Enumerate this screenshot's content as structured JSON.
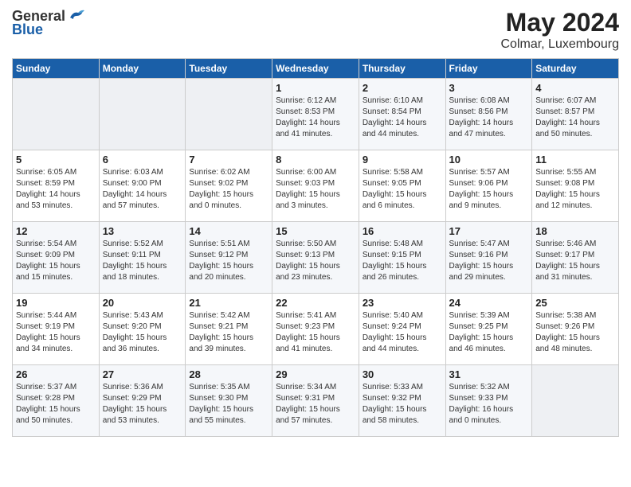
{
  "header": {
    "logo_general": "General",
    "logo_blue": "Blue",
    "month_title": "May 2024",
    "location": "Colmar, Luxembourg"
  },
  "days_of_week": [
    "Sunday",
    "Monday",
    "Tuesday",
    "Wednesday",
    "Thursday",
    "Friday",
    "Saturday"
  ],
  "weeks": [
    [
      {
        "num": "",
        "info": ""
      },
      {
        "num": "",
        "info": ""
      },
      {
        "num": "",
        "info": ""
      },
      {
        "num": "1",
        "info": "Sunrise: 6:12 AM\nSunset: 8:53 PM\nDaylight: 14 hours\nand 41 minutes."
      },
      {
        "num": "2",
        "info": "Sunrise: 6:10 AM\nSunset: 8:54 PM\nDaylight: 14 hours\nand 44 minutes."
      },
      {
        "num": "3",
        "info": "Sunrise: 6:08 AM\nSunset: 8:56 PM\nDaylight: 14 hours\nand 47 minutes."
      },
      {
        "num": "4",
        "info": "Sunrise: 6:07 AM\nSunset: 8:57 PM\nDaylight: 14 hours\nand 50 minutes."
      }
    ],
    [
      {
        "num": "5",
        "info": "Sunrise: 6:05 AM\nSunset: 8:59 PM\nDaylight: 14 hours\nand 53 minutes."
      },
      {
        "num": "6",
        "info": "Sunrise: 6:03 AM\nSunset: 9:00 PM\nDaylight: 14 hours\nand 57 minutes."
      },
      {
        "num": "7",
        "info": "Sunrise: 6:02 AM\nSunset: 9:02 PM\nDaylight: 15 hours\nand 0 minutes."
      },
      {
        "num": "8",
        "info": "Sunrise: 6:00 AM\nSunset: 9:03 PM\nDaylight: 15 hours\nand 3 minutes."
      },
      {
        "num": "9",
        "info": "Sunrise: 5:58 AM\nSunset: 9:05 PM\nDaylight: 15 hours\nand 6 minutes."
      },
      {
        "num": "10",
        "info": "Sunrise: 5:57 AM\nSunset: 9:06 PM\nDaylight: 15 hours\nand 9 minutes."
      },
      {
        "num": "11",
        "info": "Sunrise: 5:55 AM\nSunset: 9:08 PM\nDaylight: 15 hours\nand 12 minutes."
      }
    ],
    [
      {
        "num": "12",
        "info": "Sunrise: 5:54 AM\nSunset: 9:09 PM\nDaylight: 15 hours\nand 15 minutes."
      },
      {
        "num": "13",
        "info": "Sunrise: 5:52 AM\nSunset: 9:11 PM\nDaylight: 15 hours\nand 18 minutes."
      },
      {
        "num": "14",
        "info": "Sunrise: 5:51 AM\nSunset: 9:12 PM\nDaylight: 15 hours\nand 20 minutes."
      },
      {
        "num": "15",
        "info": "Sunrise: 5:50 AM\nSunset: 9:13 PM\nDaylight: 15 hours\nand 23 minutes."
      },
      {
        "num": "16",
        "info": "Sunrise: 5:48 AM\nSunset: 9:15 PM\nDaylight: 15 hours\nand 26 minutes."
      },
      {
        "num": "17",
        "info": "Sunrise: 5:47 AM\nSunset: 9:16 PM\nDaylight: 15 hours\nand 29 minutes."
      },
      {
        "num": "18",
        "info": "Sunrise: 5:46 AM\nSunset: 9:17 PM\nDaylight: 15 hours\nand 31 minutes."
      }
    ],
    [
      {
        "num": "19",
        "info": "Sunrise: 5:44 AM\nSunset: 9:19 PM\nDaylight: 15 hours\nand 34 minutes."
      },
      {
        "num": "20",
        "info": "Sunrise: 5:43 AM\nSunset: 9:20 PM\nDaylight: 15 hours\nand 36 minutes."
      },
      {
        "num": "21",
        "info": "Sunrise: 5:42 AM\nSunset: 9:21 PM\nDaylight: 15 hours\nand 39 minutes."
      },
      {
        "num": "22",
        "info": "Sunrise: 5:41 AM\nSunset: 9:23 PM\nDaylight: 15 hours\nand 41 minutes."
      },
      {
        "num": "23",
        "info": "Sunrise: 5:40 AM\nSunset: 9:24 PM\nDaylight: 15 hours\nand 44 minutes."
      },
      {
        "num": "24",
        "info": "Sunrise: 5:39 AM\nSunset: 9:25 PM\nDaylight: 15 hours\nand 46 minutes."
      },
      {
        "num": "25",
        "info": "Sunrise: 5:38 AM\nSunset: 9:26 PM\nDaylight: 15 hours\nand 48 minutes."
      }
    ],
    [
      {
        "num": "26",
        "info": "Sunrise: 5:37 AM\nSunset: 9:28 PM\nDaylight: 15 hours\nand 50 minutes."
      },
      {
        "num": "27",
        "info": "Sunrise: 5:36 AM\nSunset: 9:29 PM\nDaylight: 15 hours\nand 53 minutes."
      },
      {
        "num": "28",
        "info": "Sunrise: 5:35 AM\nSunset: 9:30 PM\nDaylight: 15 hours\nand 55 minutes."
      },
      {
        "num": "29",
        "info": "Sunrise: 5:34 AM\nSunset: 9:31 PM\nDaylight: 15 hours\nand 57 minutes."
      },
      {
        "num": "30",
        "info": "Sunrise: 5:33 AM\nSunset: 9:32 PM\nDaylight: 15 hours\nand 58 minutes."
      },
      {
        "num": "31",
        "info": "Sunrise: 5:32 AM\nSunset: 9:33 PM\nDaylight: 16 hours\nand 0 minutes."
      },
      {
        "num": "",
        "info": ""
      }
    ]
  ]
}
